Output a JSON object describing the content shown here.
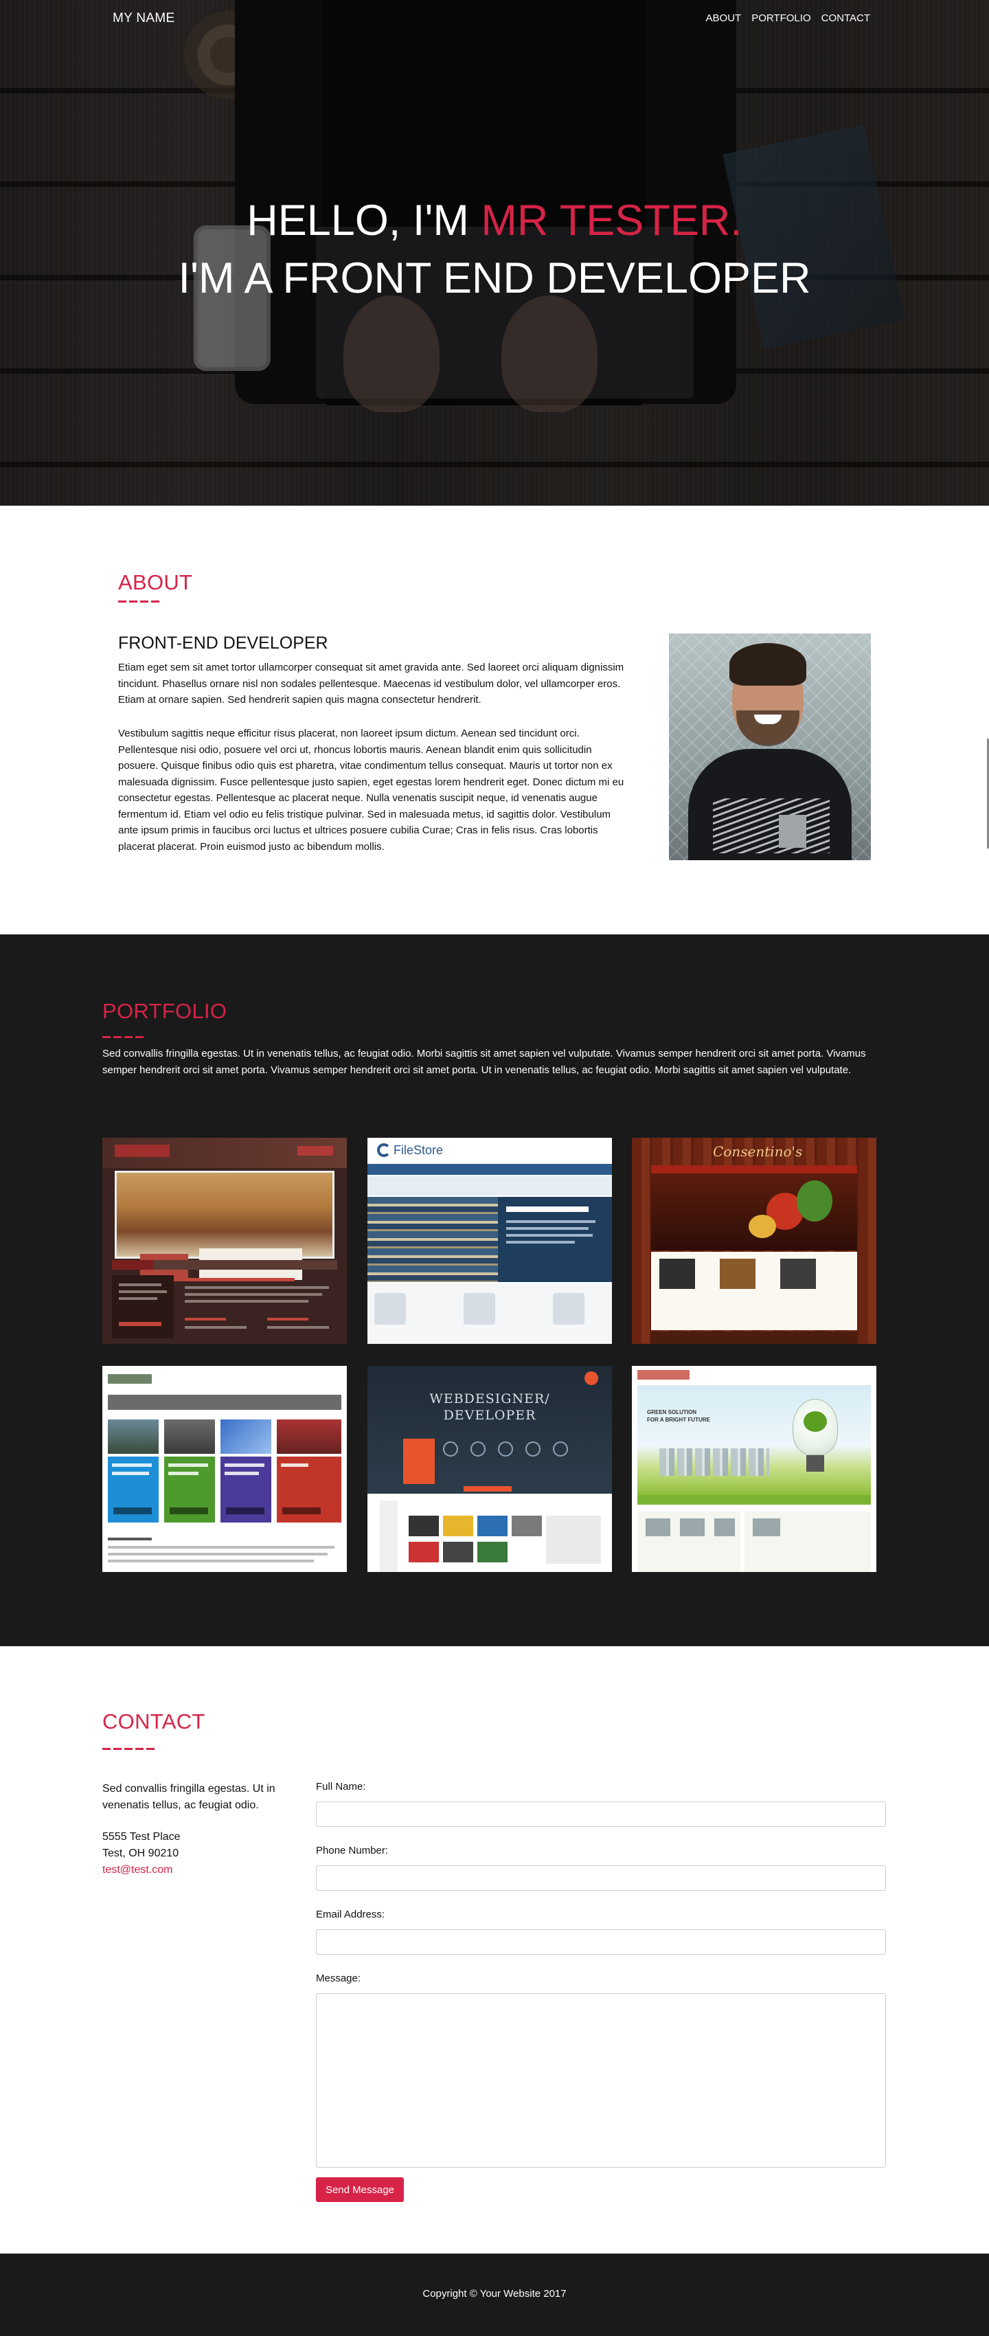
{
  "nav": {
    "brand": "MY NAME",
    "items": [
      "ABOUT",
      "PORTFOLIO",
      "CONTACT"
    ]
  },
  "hero": {
    "greeting": "HELLO, I'M ",
    "name": "MR TESTER.",
    "tagline": "I'M A FRONT END DEVELOPER"
  },
  "about": {
    "title": "ABOUT",
    "subtitle": "FRONT-END DEVELOPER",
    "paragraph1": "Etiam eget sem sit amet tortor ullamcorper consequat sit amet gravida ante. Sed laoreet orci aliquam dignissim tincidunt. Phasellus ornare nisl non sodales pellentesque. Maecenas id vestibulum dolor, vel ullamcorper eros. Etiam at ornare sapien. Sed hendrerit sapien quis magna consectetur hendrerit.",
    "paragraph2": "Vestibulum sagittis neque efficitur risus placerat, non laoreet ipsum dictum. Aenean sed tincidunt orci. Pellentesque nisi odio, posuere vel orci ut, rhoncus lobortis mauris. Aenean blandit enim quis sollicitudin posuere. Quisque finibus odio quis est pharetra, vitae condimentum tellus consequat. Mauris ut tortor non ex malesuada dignissim. Fusce pellentesque justo sapien, eget egestas lorem hendrerit eget. Donec dictum mi eu consectetur egestas. Pellentesque ac placerat neque. Nulla venenatis suscipit neque, id venenatis augue fermentum id. Etiam vel odio eu felis tristique pulvinar. Sed in malesuada metus, id sagittis dolor. Vestibulum ante ipsum primis in faucibus orci luctus et ultrices posuere cubilia Curae; Cras in felis risus. Cras lobortis placerat placerat. Proin euismod justo ac bibendum mollis."
  },
  "portfolio": {
    "title": "PORTFOLIO",
    "lead": "Sed convallis fringilla egestas. Ut in venenatis tellus, ac feugiat odio. Morbi sagittis sit amet sapien vel vulputate. Vivamus semper hendrerit orci sit amet porta. Vivamus semper hendrerit orci sit amet porta. Vivamus semper hendrerit orci sit amet porta. Ut in venenatis tellus, ac feugiat odio. Morbi sagittis sit amet sapien vel vulputate.",
    "thumb_texts": {
      "filestore": "FileStore",
      "consentino": "Consentino's",
      "webdesigner_line1": "WEBDESIGNER/",
      "webdesigner_line2": "DEVELOPER",
      "green_line1": "GREEN SOLUTION",
      "green_line2": "FOR A BRIGHT FUTURE"
    }
  },
  "contact": {
    "title": "CONTACT",
    "blurb": "Sed convallis fringilla egestas. Ut in venenatis tellus, ac feugiat odio.",
    "address_line1": "5555 Test Place",
    "address_line2": "Test, OH 90210",
    "email": "test@test.com",
    "form": {
      "full_name_label": "Full Name:",
      "phone_label": "Phone Number:",
      "email_label": "Email Address:",
      "message_label": "Message:",
      "full_name_value": "",
      "phone_value": "",
      "email_value": "",
      "message_value": "",
      "submit_label": "Send Message"
    }
  },
  "footer": {
    "copyright": "Copyright © Your Website 2017"
  },
  "colors": {
    "accent": "#d62347",
    "dark_section": "#1a1a1a"
  }
}
